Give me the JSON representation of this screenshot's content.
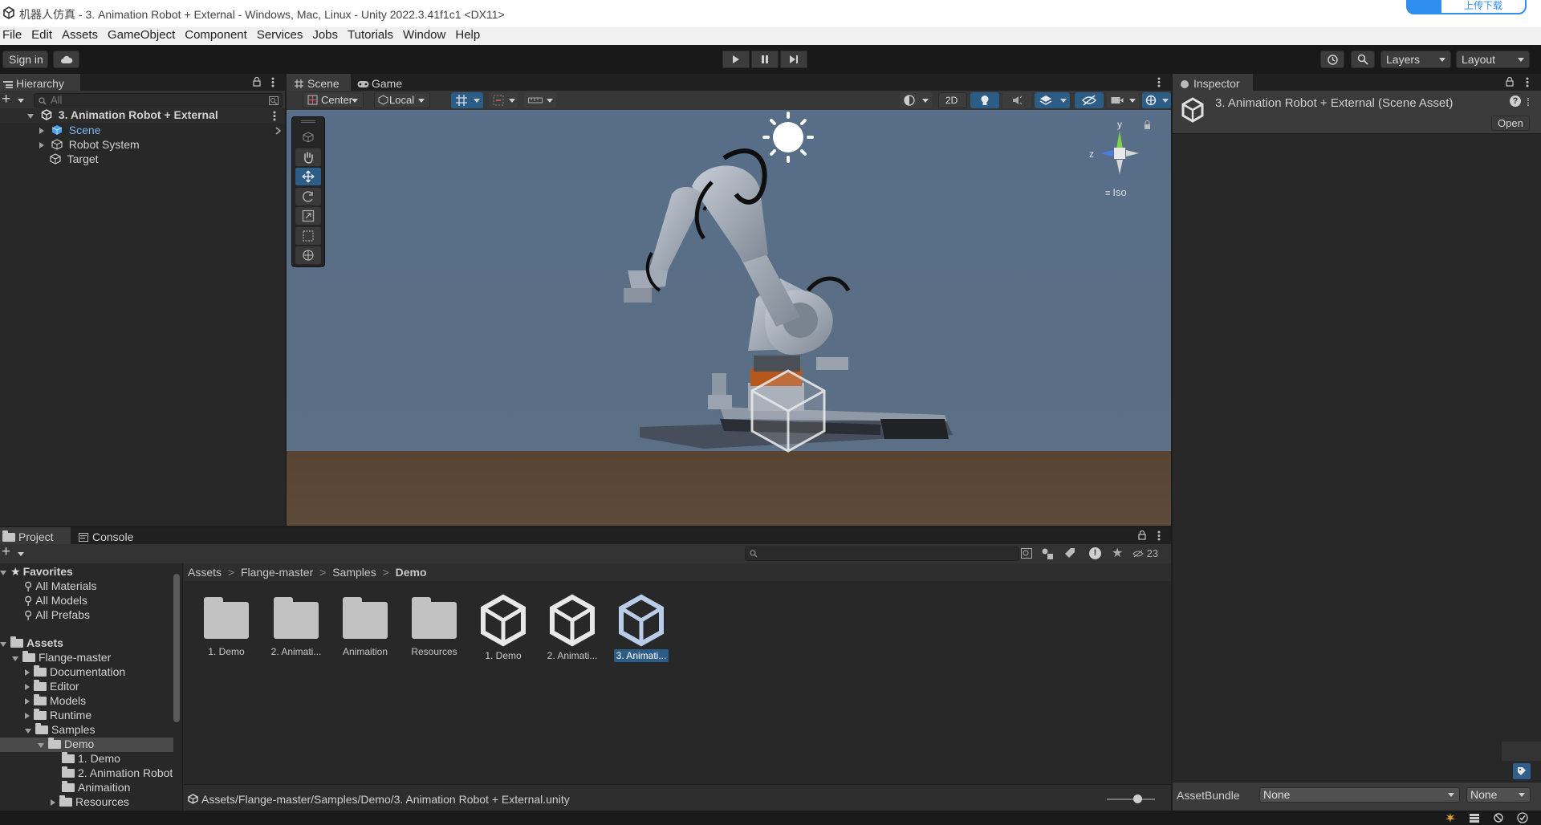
{
  "window": {
    "title": "机器人仿真 - 3. Animation Robot + External - Windows, Mac, Linux - Unity 2022.3.41f1c1 <DX11>",
    "corner_button": "上传下载"
  },
  "menu": [
    "File",
    "Edit",
    "Assets",
    "GameObject",
    "Component",
    "Services",
    "Jobs",
    "Tutorials",
    "Window",
    "Help"
  ],
  "toolbar": {
    "sign_in": "Sign in",
    "layers": "Layers",
    "layout": "Layout"
  },
  "hierarchy": {
    "tab": "Hierarchy",
    "search_placeholder": "All",
    "scene_root": "3. Animation Robot + External",
    "items": [
      "Scene",
      "Robot System",
      "Target"
    ]
  },
  "scene_view": {
    "tabs": [
      "Scene",
      "Game"
    ],
    "pivot": "Center",
    "space": "Local",
    "mode_2d": "2D",
    "gizmo": {
      "y": "y",
      "z": "z",
      "projection": "Iso"
    }
  },
  "inspector": {
    "tab": "Inspector",
    "title": "3. Animation Robot + External (Scene Asset)",
    "open_button": "Open",
    "assetbundle_label": "AssetBundle",
    "assetbundle_value": "None",
    "variant_value": "None"
  },
  "project": {
    "tabs": [
      "Project",
      "Console"
    ],
    "hidden_count": "23",
    "favorites_label": "Favorites",
    "favorites": [
      "All Materials",
      "All Models",
      "All Prefabs"
    ],
    "assets_label": "Assets",
    "tree": {
      "root": "Flange-master",
      "children": [
        "Documentation",
        "Editor",
        "Models",
        "Runtime",
        "Samples"
      ],
      "samples_child": "Demo",
      "demo_children": [
        "1. Demo",
        "2. Animation Robot",
        "Animaition",
        "Resources"
      ]
    },
    "breadcrumb": [
      "Assets",
      "Flange-master",
      "Samples",
      "Demo"
    ],
    "grid": [
      {
        "kind": "folder",
        "label": "1. Demo"
      },
      {
        "kind": "folder",
        "label": "2. Animati..."
      },
      {
        "kind": "folder",
        "label": "Animaition"
      },
      {
        "kind": "folder",
        "label": "Resources"
      },
      {
        "kind": "scene",
        "label": "1. Demo"
      },
      {
        "kind": "scene",
        "label": "2. Animati..."
      },
      {
        "kind": "scene",
        "label": "3. Animati...",
        "selected": true
      }
    ],
    "path": "Assets/Flange-master/Samples/Demo/3. Animation Robot + External.unity"
  },
  "colors": {
    "accent": "#2c5d87",
    "selected_text": "#7bb8f5",
    "sky": "#5a6f88",
    "ground": "#5a4636"
  }
}
